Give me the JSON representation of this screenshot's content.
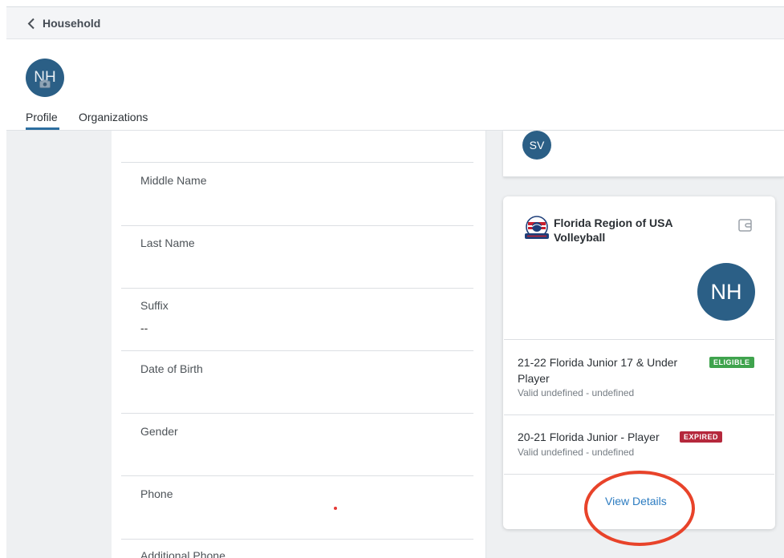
{
  "header": {
    "back_label": "Household",
    "avatar_initials": "NH"
  },
  "tabs": [
    {
      "label": "Profile",
      "active": true
    },
    {
      "label": "Organizations",
      "active": false
    }
  ],
  "form": {
    "fields": [
      {
        "label": "Middle Name",
        "value": ""
      },
      {
        "label": "Last Name",
        "value": ""
      },
      {
        "label": "Suffix",
        "value": "--"
      },
      {
        "label": "Date of Birth",
        "value": ""
      },
      {
        "label": "Gender",
        "value": ""
      },
      {
        "label": "Phone",
        "value": ""
      },
      {
        "label": "Additional Phone",
        "value": ""
      }
    ]
  },
  "right": {
    "top_card_avatar": "SV",
    "org_card": {
      "org_name": "Florida Region of USA Volleyball",
      "member_avatar": "NH",
      "memberships": [
        {
          "title": "21-22 Florida Junior 17 & Under Player",
          "status": "ELIGIBLE",
          "valid": "Valid undefined - undefined"
        },
        {
          "title": "20-21 Florida Junior - Player",
          "status": "EXPIRED",
          "valid": "Valid undefined - undefined"
        }
      ],
      "view_details": "View Details"
    }
  },
  "colors": {
    "brand_blue": "#2b5f86",
    "link": "#2c7cc1",
    "eligible": "#3fa34d",
    "expired": "#b5283c",
    "annotation": "#e8432a"
  }
}
